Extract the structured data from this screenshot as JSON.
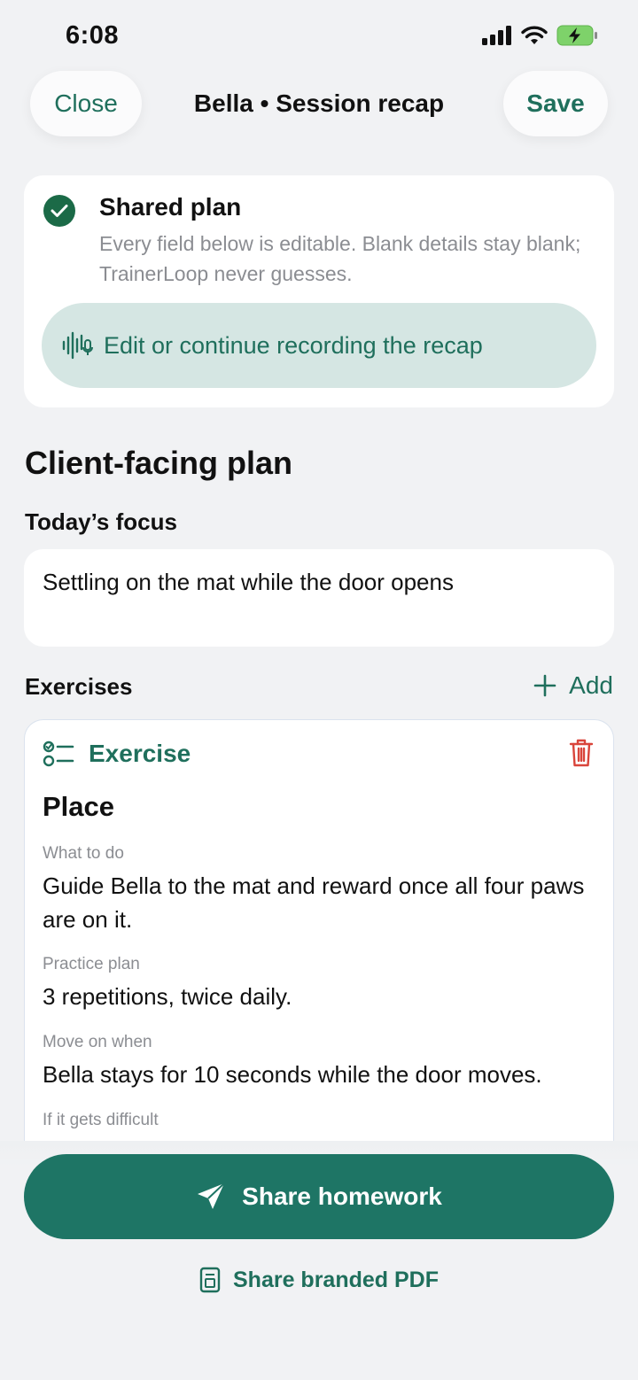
{
  "status": {
    "time": "6:08"
  },
  "nav": {
    "close_label": "Close",
    "title": "Bella • Session recap",
    "save_label": "Save"
  },
  "shared": {
    "title": "Shared plan",
    "description": "Every field below is editable. Blank details stay blank; TrainerLoop never guesses.",
    "record_label": "Edit or continue recording the recap"
  },
  "plan": {
    "section_title": "Client-facing plan",
    "focus_label": "Today’s focus",
    "focus_value": "Settling on the mat while the door opens"
  },
  "exercises": {
    "label": "Exercises",
    "add_label": "Add",
    "card": {
      "header": "Exercise",
      "name": "Place",
      "fields": [
        {
          "label": "What to do",
          "value": "Guide Bella to the mat and reward once all four paws are on it."
        },
        {
          "label": "Practice plan",
          "value": "3 repetitions, twice daily."
        },
        {
          "label": "Move on when",
          "value": "Bella stays for 10 seconds while the door moves."
        },
        {
          "label": "If it gets difficult",
          "value": ""
        }
      ]
    }
  },
  "actions": {
    "share_label": "Share homework",
    "pdf_label": "Share branded PDF"
  },
  "colors": {
    "accent": "#1f6f5c",
    "primary_button": "#1e7565",
    "check": "#1b6a47",
    "delete": "#d9453b"
  },
  "icons": [
    "signal-icon",
    "wifi-icon",
    "battery-icon",
    "check-icon",
    "waveform-mic-icon",
    "plus-icon",
    "checklist-icon",
    "trash-icon",
    "send-icon",
    "document-icon"
  ]
}
